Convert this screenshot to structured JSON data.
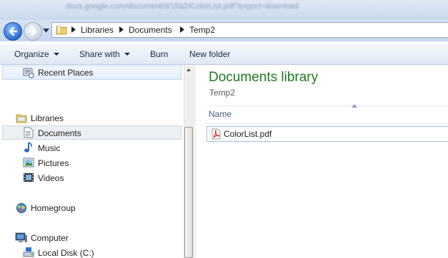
{
  "window": {
    "blurred_title": "docs.google.com/document/d/1f/a2/ColorList.pdf?export=download"
  },
  "address": {
    "crumbs": [
      "Libraries",
      "Documents",
      "Temp2"
    ]
  },
  "toolbar": {
    "organize": "Organize",
    "share_with": "Share with",
    "burn": "Burn",
    "new_folder": "New folder"
  },
  "nav": {
    "recent_places": "Recent Places",
    "libraries": "Libraries",
    "documents": "Documents",
    "music": "Music",
    "pictures": "Pictures",
    "videos": "Videos",
    "homegroup": "Homegroup",
    "computer": "Computer",
    "local_disk": "Local Disk (C:)"
  },
  "content": {
    "title": "Documents library",
    "subtitle": "Temp2",
    "column_name": "Name",
    "files": [
      "ColorList.pdf"
    ]
  },
  "colors": {
    "library_title": "#1e7a22",
    "selection_border": "#9fc0e8"
  }
}
